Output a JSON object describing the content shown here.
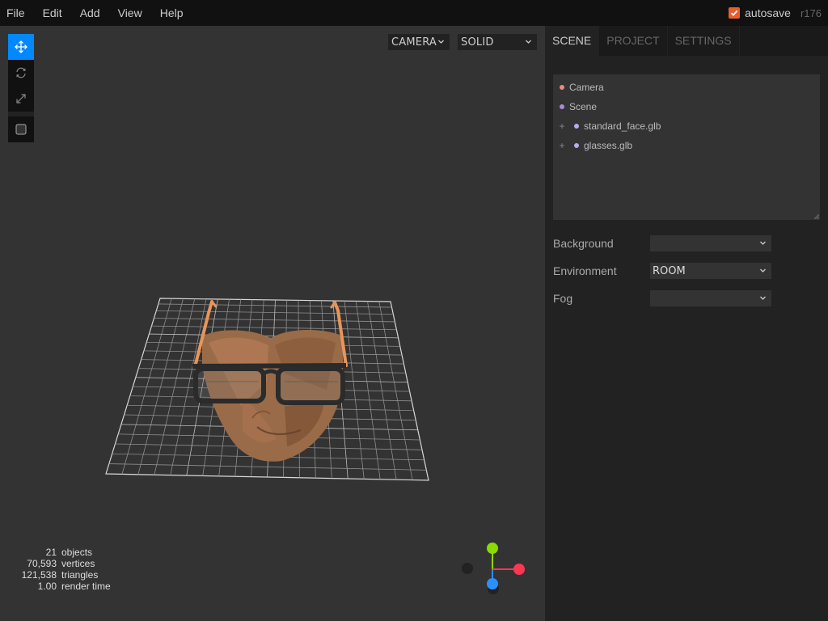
{
  "menubar": {
    "items": [
      "File",
      "Edit",
      "Add",
      "View",
      "Help"
    ],
    "autosave_label": "autosave",
    "autosave_checked": true,
    "revision": "r176"
  },
  "toolbar": {
    "tools": [
      {
        "name": "translate",
        "icon": "move-arrows-icon",
        "active": true
      },
      {
        "name": "rotate",
        "icon": "rotate-icon",
        "active": false
      },
      {
        "name": "scale",
        "icon": "scale-arrows-icon",
        "active": false
      },
      {
        "name": "local",
        "icon": "checkbox-icon",
        "active": false
      }
    ]
  },
  "viewport": {
    "camera_select": "CAMERA",
    "shading_select": "SOLID"
  },
  "info": {
    "rows": [
      {
        "value": "21",
        "label": "objects"
      },
      {
        "value": "70,593",
        "label": "vertices"
      },
      {
        "value": "121,538",
        "label": "triangles"
      },
      {
        "value": "1.00",
        "label": "render time"
      }
    ]
  },
  "sidebar": {
    "tabs": [
      "SCENE",
      "PROJECT",
      "SETTINGS"
    ],
    "selected_tab": "SCENE",
    "outliner": [
      {
        "label": "Camera",
        "dot_color": "#e88",
        "opener": false
      },
      {
        "label": "Scene",
        "dot_color": "#aa88dd",
        "opener": false
      },
      {
        "label": "standard_face.glb",
        "dot_color": "#bbaaee",
        "opener": true
      },
      {
        "label": "glasses.glb",
        "dot_color": "#bbaaee",
        "opener": true
      }
    ],
    "properties": {
      "background": {
        "label": "Background",
        "value": ""
      },
      "environment": {
        "label": "Environment",
        "value": "ROOM"
      },
      "fog": {
        "label": "Fog",
        "value": ""
      }
    }
  },
  "colors": {
    "accent": "#0088ff",
    "autosave_check": "#e85d2a",
    "axis_x": "#ff3653",
    "axis_y": "#8adb00",
    "axis_z": "#2c8fff"
  }
}
